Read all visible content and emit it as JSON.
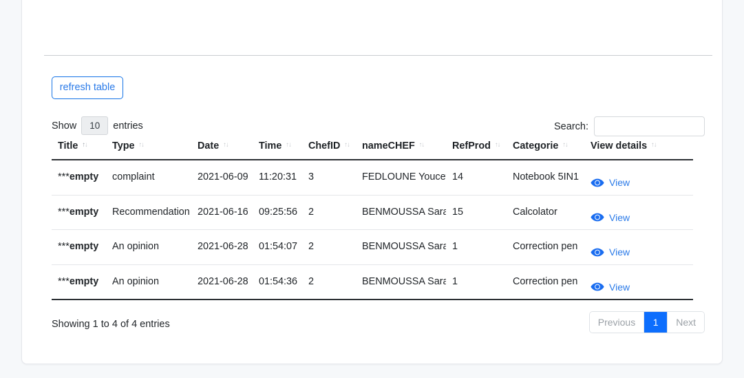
{
  "theme": {
    "page_background": "#f6f8fa",
    "card_background": "#ffffff",
    "accent_blue": "#0d6efd",
    "link_blue": "#2a7ae8",
    "text": "#212529",
    "border": "#dee2e6"
  },
  "toolbar": {
    "refresh_label": "refresh table"
  },
  "controls": {
    "length_prefix": "Show",
    "length_value": "10",
    "length_suffix": "entries",
    "search_label": "Search:",
    "search_value": "",
    "search_placeholder": ""
  },
  "table": {
    "columns": [
      {
        "key": "title",
        "label": "Title",
        "sort_icon": "sort-both-icon"
      },
      {
        "key": "type",
        "label": "Type",
        "sort_icon": "sort-both-icon"
      },
      {
        "key": "date",
        "label": "Date",
        "sort_icon": "sort-both-icon"
      },
      {
        "key": "time",
        "label": "Time",
        "sort_icon": "sort-both-icon"
      },
      {
        "key": "chefid",
        "label": "ChefID",
        "sort_icon": "sort-both-icon"
      },
      {
        "key": "namechef",
        "label": "nameCHEF",
        "sort_icon": "sort-both-icon"
      },
      {
        "key": "refprod",
        "label": "RefProd",
        "sort_icon": "sort-both-icon"
      },
      {
        "key": "categorie",
        "label": "Categorie",
        "sort_icon": "sort-both-icon"
      },
      {
        "key": "view",
        "label": "View details",
        "sort_icon": "sort-both-icon"
      }
    ],
    "rows": [
      {
        "title_stars": "***",
        "title_word": "empty",
        "type": "complaint",
        "date": "2021-06-09",
        "time": "11:20:31",
        "chefid": "3",
        "namechef": "FEDLOUNE Youcef",
        "refprod": "14",
        "categorie": "Notebook 5IN1",
        "view_label": "View",
        "view_icon": "eye-icon"
      },
      {
        "title_stars": "***",
        "title_word": "empty",
        "type": "Recommendation",
        "date": "2021-06-16",
        "time": "09:25:56",
        "chefid": "2",
        "namechef": "BENMOUSSA Sara",
        "refprod": "15",
        "categorie": "Calcolator",
        "view_label": "View",
        "view_icon": "eye-icon"
      },
      {
        "title_stars": "***",
        "title_word": "empty",
        "type": "An opinion",
        "date": "2021-06-28",
        "time": "01:54:07",
        "chefid": "2",
        "namechef": "BENMOUSSA Sara",
        "refprod": "1",
        "categorie": "Correction pen",
        "view_label": "View",
        "view_icon": "eye-icon"
      },
      {
        "title_stars": "***",
        "title_word": "empty",
        "type": "An opinion",
        "date": "2021-06-28",
        "time": "01:54:36",
        "chefid": "2",
        "namechef": "BENMOUSSA Sara",
        "refprod": "1",
        "categorie": "Correction pen",
        "view_label": "View",
        "view_icon": "eye-icon"
      }
    ]
  },
  "footer": {
    "info": "Showing 1 to 4 of 4 entries",
    "pagination": {
      "previous_label": "Previous",
      "next_label": "Next",
      "pages": [
        {
          "label": "1",
          "active": true
        }
      ]
    }
  }
}
